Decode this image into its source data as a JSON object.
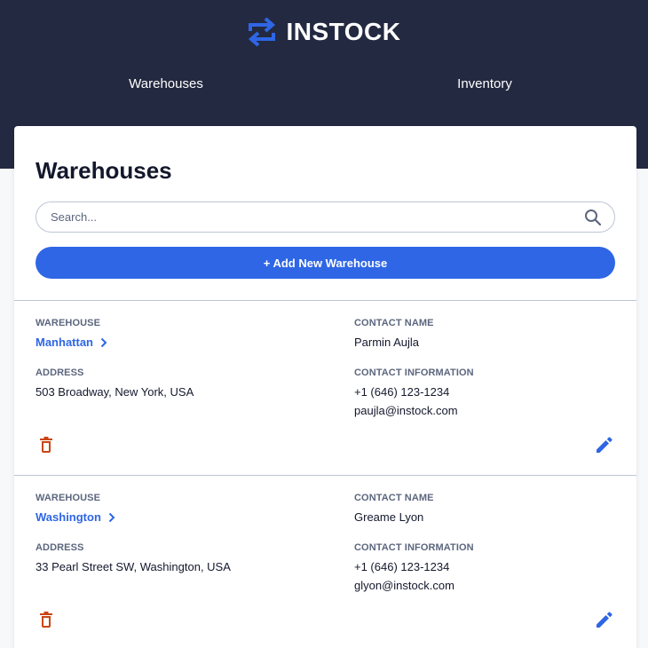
{
  "brand": {
    "name": "INSTOCK",
    "logo_icon": "swap-arrows-icon",
    "logo_color": "#2E66E5"
  },
  "nav": {
    "items": [
      {
        "label": "Warehouses"
      },
      {
        "label": "Inventory"
      }
    ]
  },
  "page": {
    "title": "Warehouses",
    "search_placeholder": "Search...",
    "search_value": "",
    "add_button_label": "+ Add New Warehouse"
  },
  "labels": {
    "warehouse": "WAREHOUSE",
    "contact_name": "CONTACT NAME",
    "address": "ADDRESS",
    "contact_information": "CONTACT INFORMATION"
  },
  "warehouses": [
    {
      "name": "Manhattan",
      "address": "503 Broadway, New York, USA",
      "contact_name": "Parmin Aujla",
      "phone": "+1 (646) 123-1234",
      "email": "paujla@instock.com"
    },
    {
      "name": "Washington",
      "address": "33 Pearl Street SW, Washington, USA",
      "contact_name": "Greame Lyon",
      "phone": "+1 (646) 123-1234",
      "email": "glyon@instock.com"
    }
  ],
  "colors": {
    "header_bg": "#232940",
    "accent": "#2E66E5",
    "delete": "#C94515",
    "text_primary": "#13182C",
    "text_secondary": "#5C667E",
    "border": "#BDC5D5"
  }
}
